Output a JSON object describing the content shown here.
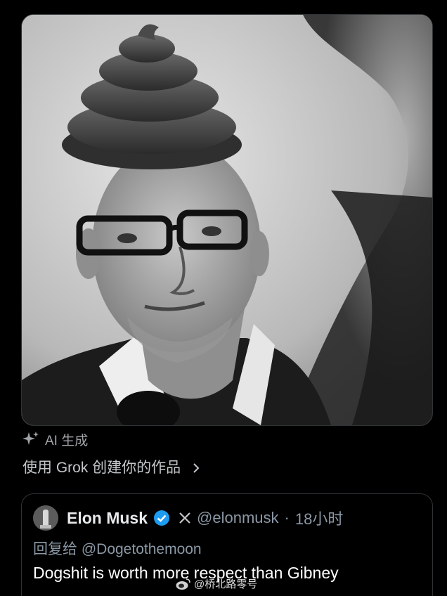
{
  "image": {
    "alt_icon": "photo"
  },
  "ai_label": {
    "icon": "sparkle-icon",
    "text": "AI 生成"
  },
  "grok_link": {
    "text": "使用 Grok 创建你的作品",
    "icon": "chevron-right-icon"
  },
  "quote": {
    "author_name": "Elon Musk",
    "verified_icon": "verified-icon",
    "platform_icon": "x-icon",
    "handle": "@elonmusk",
    "separator": "·",
    "time": "18小时",
    "reply_prefix": "回复给",
    "reply_to": "@Dogetothemoon",
    "text": "Dogshit is worth more respect than Gibney"
  },
  "watermark": {
    "logo": "weibo-logo",
    "text": "@桥北路零号"
  },
  "colors": {
    "background": "#000000",
    "border": "#2f3336",
    "muted_text": "#8b98a5",
    "verified_blue": "#1d9bf0"
  }
}
